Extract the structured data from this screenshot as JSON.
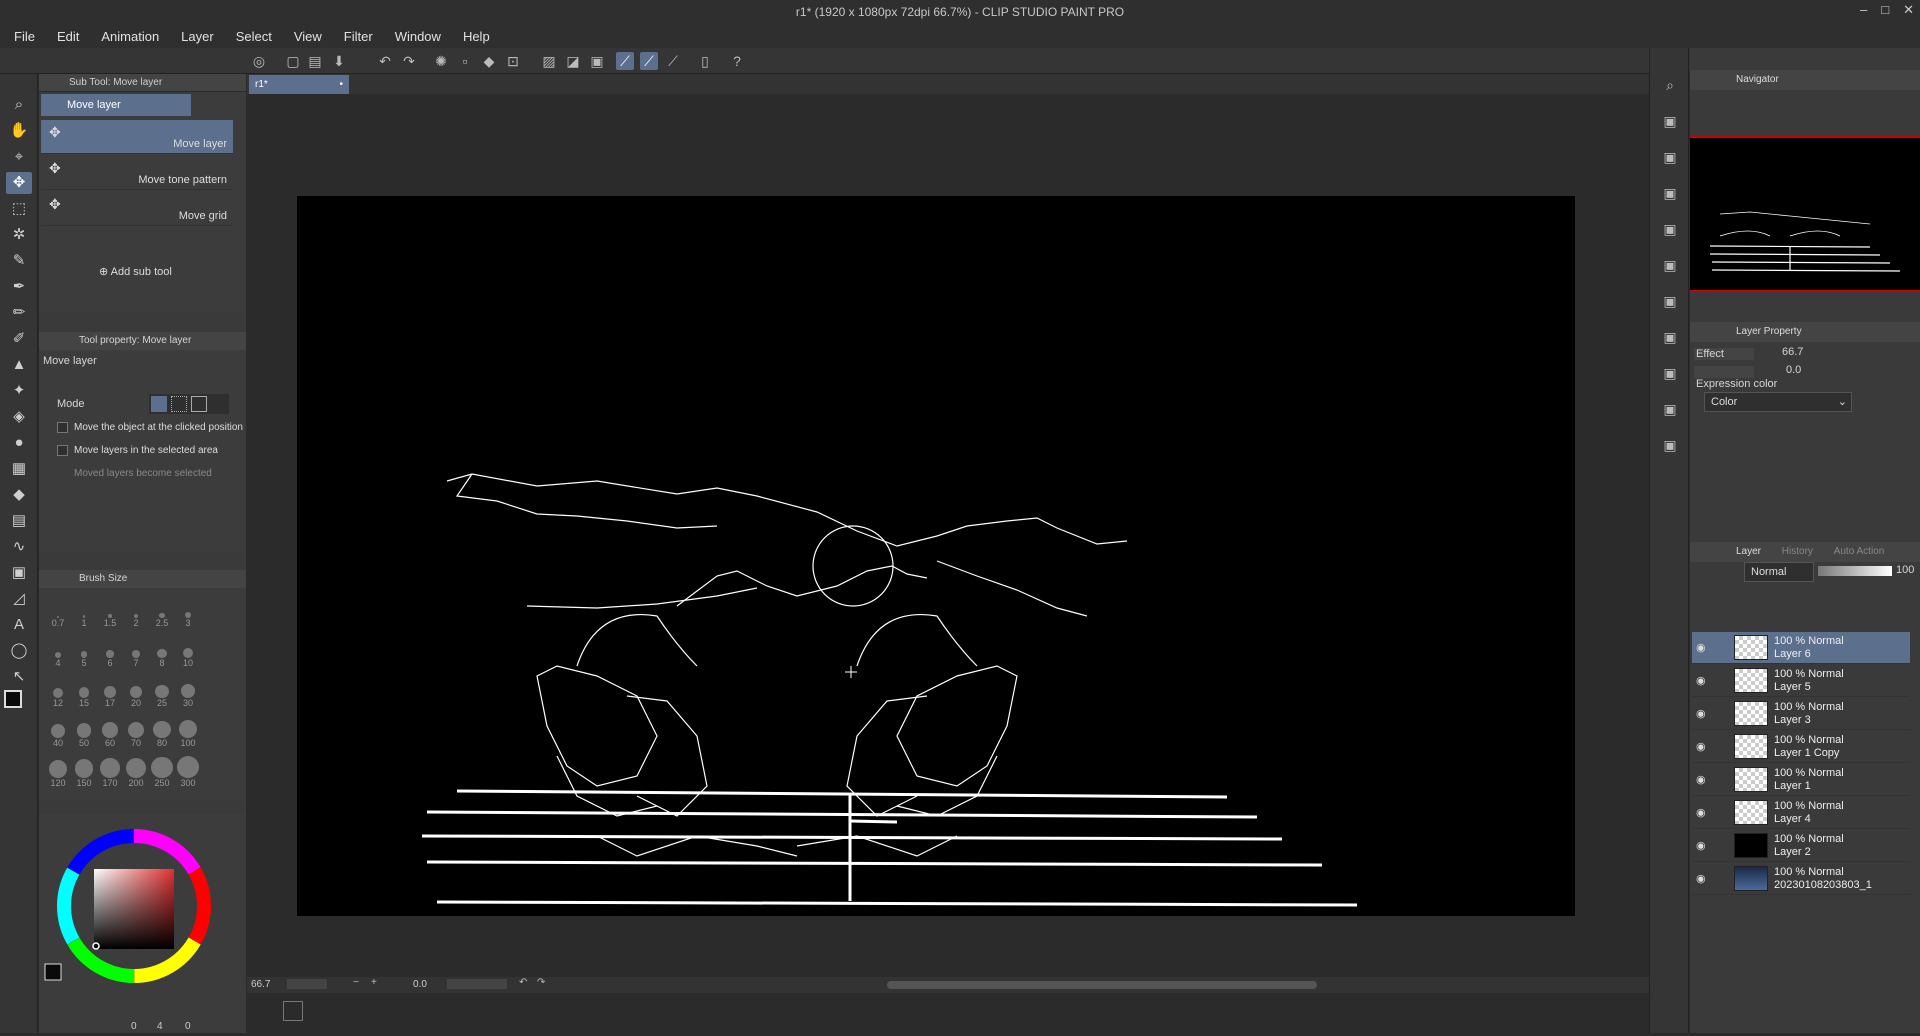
{
  "window": {
    "title": "r1* (1920 x 1080px 72dpi 66.7%)  - CLIP STUDIO PAINT PRO",
    "min": "–",
    "max": "□",
    "close": "✕"
  },
  "menu": [
    "File",
    "Edit",
    "Animation",
    "Layer",
    "Select",
    "View",
    "Filter",
    "Window",
    "Help"
  ],
  "subtool": {
    "header": "Sub Tool: Move layer",
    "selected": "Move layer",
    "items": [
      "Move layer",
      "Move tone pattern",
      "Move grid"
    ],
    "add": "Add sub tool"
  },
  "tool_property": {
    "header": "Tool property: Move layer",
    "name": "Move layer",
    "mode_label": "Mode",
    "options": [
      "Move the object at the clicked position",
      "Move layers in the selected area",
      "Moved layers become selected"
    ]
  },
  "brush_size": {
    "header": "Brush Size",
    "sizes": [
      "0.7",
      "1",
      "1.5",
      "2",
      "2.5",
      "3",
      "4",
      "5",
      "6",
      "7",
      "8",
      "10",
      "12",
      "15",
      "17",
      "20",
      "25",
      "30",
      "40",
      "50",
      "60",
      "70",
      "80",
      "100",
      "120",
      "150",
      "170",
      "200",
      "250",
      "300"
    ]
  },
  "color": {
    "main": "#0a0a0a",
    "sub": "#ffffff",
    "values": [
      "0",
      "4",
      "0"
    ]
  },
  "canvas": {
    "tab": "r1*",
    "zoom": "66.7",
    "angle": "0.0"
  },
  "navigator": {
    "header": "Navigator",
    "zoom": "66.7",
    "rotation": "0.0"
  },
  "layer_property": {
    "header": "Layer Property",
    "effect": "Effect",
    "expression_color_label": "Expression color",
    "expression_color": "Color"
  },
  "layer_panel": {
    "tabs": [
      "Layer",
      "History",
      "Auto Action"
    ],
    "blend_mode": "Normal",
    "opacity": "100",
    "layers": [
      {
        "info": "100 % Normal",
        "name": "Layer 6",
        "thumb": "checker",
        "selected": true
      },
      {
        "info": "100 % Normal",
        "name": "Layer 5",
        "thumb": "checker",
        "selected": false
      },
      {
        "info": "100 % Normal",
        "name": "Layer 3",
        "thumb": "checker",
        "selected": false
      },
      {
        "info": "100 % Normal",
        "name": "Layer 1 Copy",
        "thumb": "checker",
        "selected": false
      },
      {
        "info": "100 % Normal",
        "name": "Layer 1",
        "thumb": "checker",
        "selected": false
      },
      {
        "info": "100 % Normal",
        "name": "Layer 4",
        "thumb": "checker",
        "selected": false
      },
      {
        "info": "100 % Normal",
        "name": "Layer 2",
        "thumb": "black",
        "selected": false
      },
      {
        "info": "100 % Normal",
        "name": "20230108203803_1",
        "thumb": "photo",
        "selected": false
      }
    ]
  },
  "accent": "#5c6f8c"
}
